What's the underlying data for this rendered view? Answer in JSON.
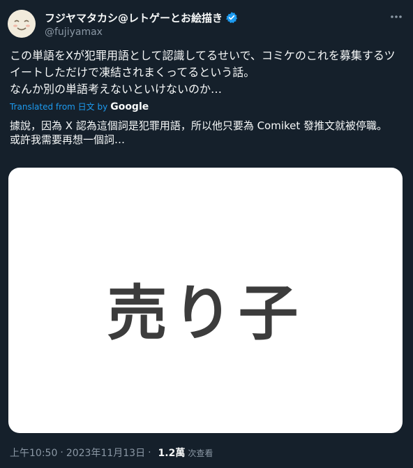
{
  "author": {
    "display_name": "フジヤマタカシ@レトゲーとお絵描き",
    "handle": "@fujiyamax",
    "verified_icon": "verified-badge-icon",
    "avatar_icon": "smiley-face-avatar"
  },
  "tweet": {
    "text": "この単語をXが犯罪用語として認識してるせいで、コミケのこれを募集するツイートしただけで凍結されまくってるという話。\nなんか別の単語考えないといけないのか…",
    "translated_from": "Translated from 日文 by",
    "translator": "Google",
    "translation": "據說，因為 X 認為這個詞是犯罪用語，所以他只要為 Comiket 發推文就被停職。\n或許我需要再想一個詞…",
    "media_text": "売り子"
  },
  "footer": {
    "time": "上午10:50",
    "date": "2023年11月13日",
    "separator": "·",
    "views_count": "1.2萬",
    "views_label": "次查看"
  },
  "colors": {
    "background": "#15202b",
    "text_primary": "#f7f9f9",
    "text_secondary": "#8b98a5",
    "accent": "#1d9bf0",
    "verified": "#1d9bf0"
  }
}
